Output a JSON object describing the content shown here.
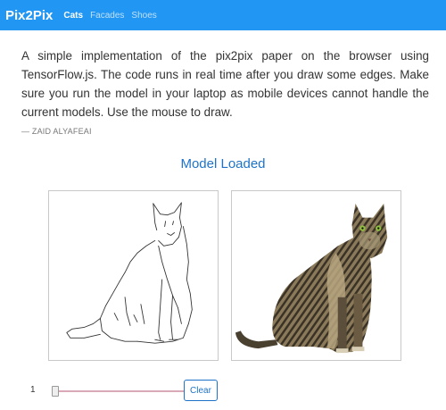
{
  "navbar": {
    "brand": "Pix2Pix",
    "links": [
      {
        "label": "Cats",
        "active": true
      },
      {
        "label": "Facades",
        "active": false
      },
      {
        "label": "Shoes",
        "active": false
      }
    ]
  },
  "intro": {
    "text": "A simple implementation of the pix2pix paper on the browser using TensorFlow.js. The code runs in real time after you draw some edges. Make sure you run the model in your laptop as mobile devices cannot handle the current models. Use the mouse to draw.",
    "author": "— ZAID ALYAFEAI"
  },
  "status": "Model Loaded",
  "controls": {
    "slider_value": "1",
    "slider_fraction": 0.0,
    "clear_label": "Clear"
  },
  "colors": {
    "navbar": "#2196f3",
    "accent": "#1e73c9"
  }
}
